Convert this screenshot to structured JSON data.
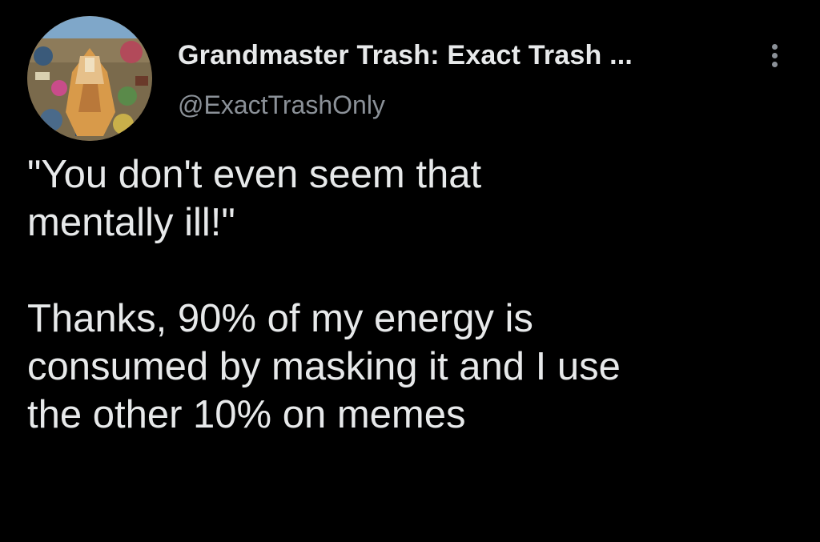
{
  "tweet": {
    "display_name": "Grandmaster Trash: Exact Trash ...",
    "handle": "@ExactTrashOnly",
    "more_icon": "more-vertical-icon",
    "avatar_icon": "profile-avatar",
    "text": {
      "line1": "\"You don't even seem that",
      "line2": "mentally ill!\"",
      "line3": "Thanks, 90% of my energy is",
      "line4": "consumed by masking it and I use",
      "line5": "the other 10% on memes"
    }
  },
  "colors": {
    "background": "#000000",
    "primary_text": "#e7e9ea",
    "secondary_text": "#8b9198"
  }
}
